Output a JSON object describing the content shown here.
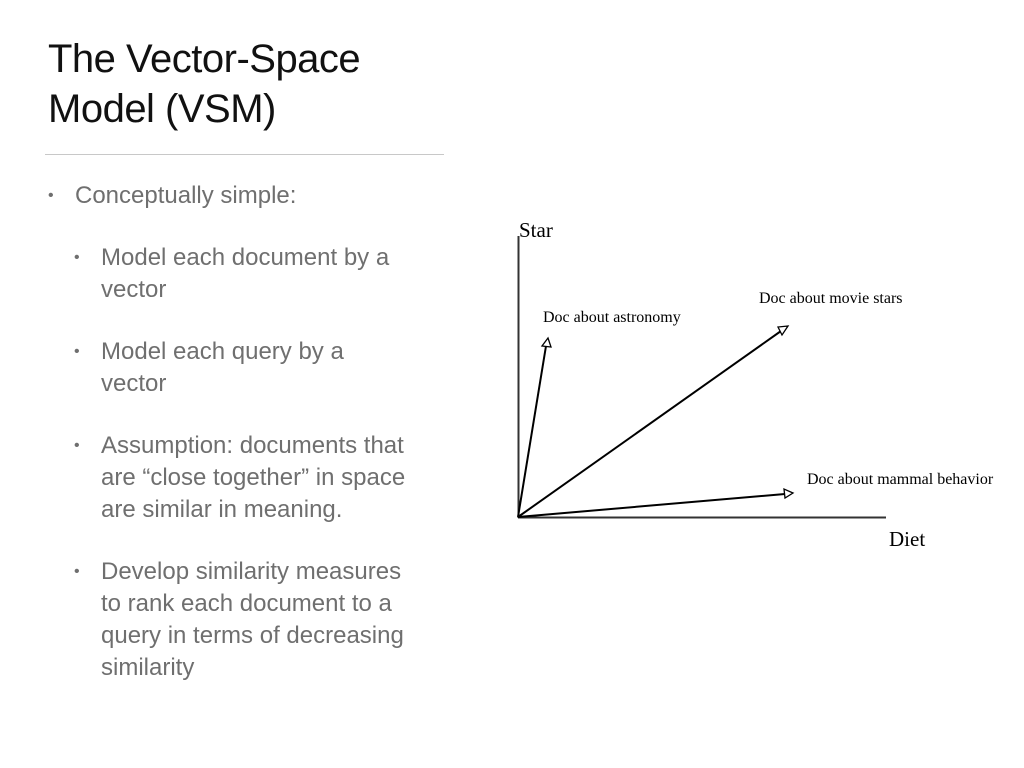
{
  "slide": {
    "title_lines": [
      "The Vector-Space",
      "Model (VSM)"
    ],
    "bullets": {
      "main": "Conceptually simple:",
      "sub": [
        [
          "Model each document by a",
          "vector"
        ],
        [
          "Model each query by a",
          "vector"
        ],
        [
          "Assumption: documents that",
          "are “close together” in space",
          "are similar in meaning."
        ],
        [
          "Develop similarity measures",
          "to rank each document to a",
          "query in terms of decreasing",
          "similarity"
        ]
      ],
      "marker": "•"
    }
  },
  "diagram": {
    "y_axis_label": "Star",
    "x_axis_label": "Diet",
    "vectors": [
      {
        "label": "Doc about astronomy"
      },
      {
        "label": "Doc about movie stars"
      },
      {
        "label": "Doc about mammal behavior"
      }
    ],
    "colors": {
      "line": "#000000",
      "axis": "#333333"
    }
  },
  "colors": {
    "title": "#111111",
    "body_text": "#6f6f6f",
    "divider": "#c8c8c8",
    "background": "#ffffff"
  }
}
